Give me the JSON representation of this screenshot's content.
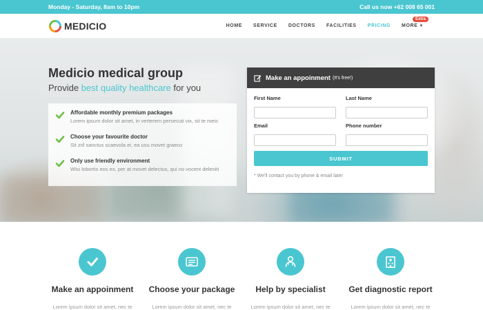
{
  "topbar": {
    "hours": "Monday - Saturday, 8am to 10pm",
    "phone": "Call us now +62 008 65 001"
  },
  "brand": {
    "name": "MEDICIO"
  },
  "nav": {
    "items": [
      "HOME",
      "SERVICE",
      "DOCTORS",
      "FACILITIES",
      "PRICING"
    ],
    "active_index": 4,
    "more_label": "MORE",
    "extra_badge": "Extra"
  },
  "hero": {
    "title": "Medicio medical group",
    "subtitle_pre": "Provide ",
    "subtitle_highlight": "best quality healthcare",
    "subtitle_post": " for you",
    "features": [
      {
        "title": "Affordable monthly premium packages",
        "desc": "Lorem ipsum dolor sit amet, in verterem persecuti vix, sit te meis"
      },
      {
        "title": "Choose your favourite doctor",
        "desc": "Sit zril sanctus scaevola ei, ea usu movet graeco"
      },
      {
        "title": "Only use friendly environment",
        "desc": "Wisi lobortis eos ex, per at movet delectus, qui no vocent deleniti"
      }
    ]
  },
  "form": {
    "title": "Make an appoinment",
    "title_note": "(It's free!)",
    "first_name_label": "First Name",
    "last_name_label": "Last Name",
    "email_label": "Email",
    "phone_label": "Phone number",
    "submit_label": "SUBMIT",
    "note": "* We'll contact you by phone & email later"
  },
  "services": [
    {
      "icon": "check-icon",
      "title": "Make an appoinment",
      "desc": "Lorem ipsum dolor sit amet, nec te"
    },
    {
      "icon": "package-card-icon",
      "title": "Choose your package",
      "desc": "Lorem ipsum dolor sit amet, nec te"
    },
    {
      "icon": "doctor-icon",
      "title": "Help by specialist",
      "desc": "Lorem ipsum dolor sit amet, nec te"
    },
    {
      "icon": "hospital-icon",
      "title": "Get diagnostic report",
      "desc": "Lorem ipsum dolor sit amet, nec te"
    }
  ],
  "colors": {
    "accent": "#4ac6d0",
    "badge": "#e74c3c",
    "card_header": "#3f3f3f",
    "check": "#6dbe45"
  }
}
